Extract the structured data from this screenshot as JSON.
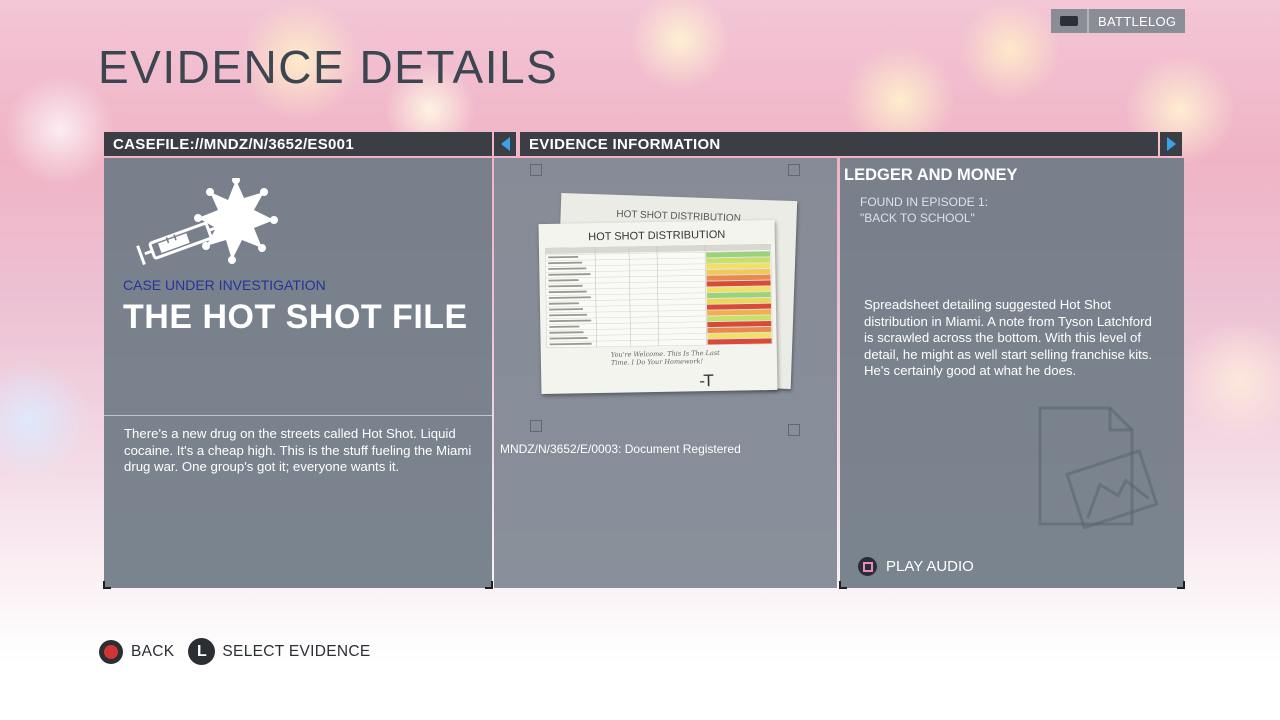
{
  "top_bar": {
    "battlelog_label": "BATTLELOG",
    "controller_icon": "controller-icon"
  },
  "page_title": "EVIDENCE DETAILS",
  "left_panel": {
    "header": "CASEFILE://MNDZ/N/3652/ES001",
    "icon": "syringe-and-badge-icon",
    "case_label": "CASE UNDER INVESTIGATION",
    "case_title": "THE HOT SHOT FILE",
    "description": "There's a new drug on the streets called Hot Shot. Liquid cocaine. It's a cheap high. This is the stuff fueling the Miami drug war. One group's got it; everyone wants it."
  },
  "middle_panel": {
    "header": "EVIDENCE INFORMATION",
    "document_back_title": "HOT SHOT DISTRIBUTION",
    "document_front_title": "HOT SHOT DISTRIBUTION",
    "handwritten_note": "You're Welcome. This Is The Last Time. I Do Your Homework!",
    "signature": "-T",
    "caption": "MNDZ/N/3652/E/0003: Document Registered"
  },
  "right_panel": {
    "title": "LEDGER AND MONEY",
    "found_line1": "FOUND IN EPISODE 1:",
    "found_line2": "\"BACK TO SCHOOL\"",
    "description": "Spreadsheet detailing suggested Hot Shot distribution in Miami.  A note from Tyson Latchford is scrawled across the bottom. With this level of detail, he might as well start selling franchise kits. He's certainly good at what he does.",
    "play_audio_label": "PLAY AUDIO",
    "play_audio_icon": "square-button-icon"
  },
  "footer": {
    "back_label": "BACK",
    "back_icon": "circle-button-icon",
    "select_label": "SELECT EVIDENCE",
    "select_button_glyph": "L"
  },
  "colors": {
    "header_bg": "#3b3f45",
    "arrow_accent": "#3aa2e8",
    "case_label": "#23349a",
    "panel_bg": "#707c86",
    "back_button": "#d03535",
    "square_button": "#e88ac8"
  }
}
